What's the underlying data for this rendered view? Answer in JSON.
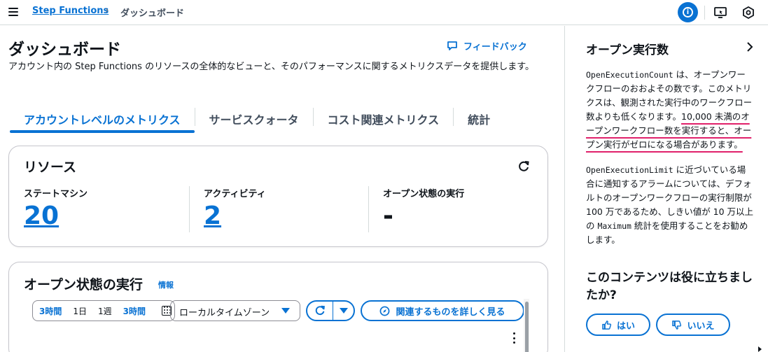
{
  "breadcrumb": {
    "root": "Step Functions",
    "current": "ダッシュボード"
  },
  "page": {
    "title": "ダッシュボード",
    "feedback": "フィードバック",
    "description": "アカウント内の Step Functions のリソースの全体的なビューと、そのパフォーマンスに関するメトリクスデータを提供します。"
  },
  "tabs": [
    {
      "label": "アカウントレベルのメトリクス",
      "active": true
    },
    {
      "label": "サービスクォータ",
      "active": false
    },
    {
      "label": "コスト関連メトリクス",
      "active": false
    },
    {
      "label": "統計",
      "active": false
    }
  ],
  "resources": {
    "title": "リソース",
    "metrics": [
      {
        "label": "ステートマシン",
        "value": "20"
      },
      {
        "label": "アクティビティ",
        "value": "2"
      },
      {
        "label": "オープン状態の実行",
        "value": "-"
      }
    ]
  },
  "open_executions": {
    "title": "オープン状態の実行",
    "info": "情報",
    "range_options": [
      "3時間",
      "1日",
      "1週",
      "3時間"
    ],
    "range_selected_index": 0,
    "timezone": "ローカルタイムゾーン",
    "explore_button": "関連するものを詳しく見る"
  },
  "help_panel": {
    "title": "オープン実行数",
    "p1_code": "OpenExecutionCount",
    "p1_text_a": " は、オープンワークフローのおおよその数です。このメトリクスは、観測された実行中のワークフロー数よりも低くなります。",
    "p1_highlight": "10,000 未満のオープンワークフロー数を実行すると、オープン実行がゼロになる場合があります。",
    "p2_code": "OpenExecutionLimit",
    "p2_text_a": " に近づいている場合に通知するアラームについては、デフォルトのオープンワークフローの実行制限が 100 万であるため、しきい値が 10 万以上の ",
    "p2_code2": "Maximum",
    "p2_text_b": " 統計を使用することをお勧めします。",
    "question": "このコンテンツは役に立ちましたか?",
    "yes": "はい",
    "no": "いいえ"
  },
  "colors": {
    "link_blue": "#0972d3",
    "text": "#0f141a",
    "highlight_underline": "#e0206a",
    "border": "#c6c6cd"
  }
}
